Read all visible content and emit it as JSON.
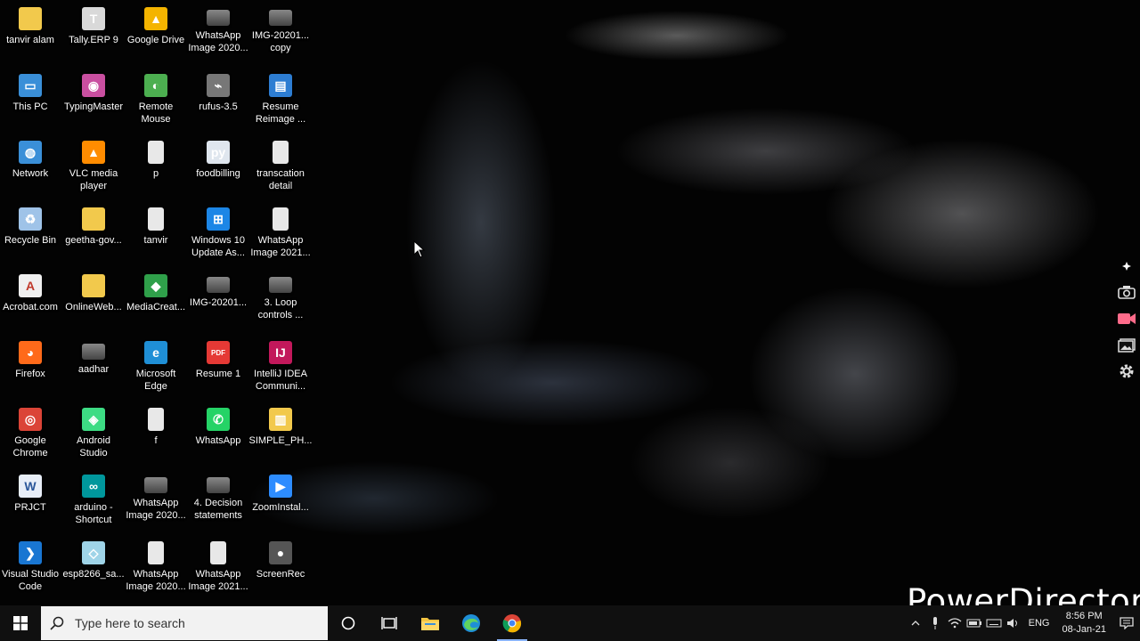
{
  "desktop": {
    "icons": [
      {
        "label": "tanvir alam",
        "icon": "user-folder-icon"
      },
      {
        "label": "Tally.ERP 9",
        "icon": "tally-icon"
      },
      {
        "label": "Google Drive",
        "icon": "google-drive-icon"
      },
      {
        "label": "WhatsApp\nImage 2020...",
        "icon": "image-file-icon"
      },
      {
        "label": "IMG-20201...\ncopy",
        "icon": "image-file-icon"
      },
      {
        "label": "This PC",
        "icon": "computer-icon"
      },
      {
        "label": "TypingMaster",
        "icon": "typingmaster-icon"
      },
      {
        "label": "Remote\nMouse",
        "icon": "remote-mouse-icon"
      },
      {
        "label": "rufus-3.5",
        "icon": "usb-icon"
      },
      {
        "label": "Resume\nReimage ...",
        "icon": "resume-icon"
      },
      {
        "label": "Network",
        "icon": "network-icon"
      },
      {
        "label": "VLC media\nplayer",
        "icon": "vlc-icon"
      },
      {
        "label": "p",
        "icon": "document-icon"
      },
      {
        "label": "foodbilling",
        "icon": "python-file-icon"
      },
      {
        "label": "transcation\ndetail",
        "icon": "document-icon"
      },
      {
        "label": "Recycle Bin",
        "icon": "recycle-bin-icon"
      },
      {
        "label": "geetha-gov...",
        "icon": "folder-icon"
      },
      {
        "label": "tanvir",
        "icon": "document-icon"
      },
      {
        "label": "Windows 10\nUpdate As...",
        "icon": "windows-icon"
      },
      {
        "label": "WhatsApp\nImage 2021...",
        "icon": "document-icon"
      },
      {
        "label": "Acrobat.com",
        "icon": "acrobat-icon"
      },
      {
        "label": "OnlineWeb...",
        "icon": "folder-icon"
      },
      {
        "label": "MediaCreat...",
        "icon": "media-creation-icon"
      },
      {
        "label": "IMG-20201...",
        "icon": "image-file-icon"
      },
      {
        "label": "3. Loop\ncontrols ...",
        "icon": "image-file-icon"
      },
      {
        "label": "Firefox",
        "icon": "firefox-icon"
      },
      {
        "label": "aadhar",
        "icon": "image-file-icon"
      },
      {
        "label": "Microsoft\nEdge",
        "icon": "edge-icon"
      },
      {
        "label": "Resume 1",
        "icon": "pdf-icon"
      },
      {
        "label": "IntelliJ IDEA\nCommuni...",
        "icon": "intellij-icon"
      },
      {
        "label": "Google\nChrome",
        "icon": "chrome-icon"
      },
      {
        "label": "Android\nStudio",
        "icon": "android-studio-icon"
      },
      {
        "label": "f",
        "icon": "document-icon"
      },
      {
        "label": "WhatsApp",
        "icon": "whatsapp-icon"
      },
      {
        "label": "SIMPLE_PH...",
        "icon": "zip-folder-icon"
      },
      {
        "label": "PRJCT",
        "icon": "word-doc-icon"
      },
      {
        "label": "arduino -\nShortcut",
        "icon": "arduino-icon"
      },
      {
        "label": "WhatsApp\nImage 2020...",
        "icon": "image-file-icon"
      },
      {
        "label": "4. Decision\nstatements",
        "icon": "image-file-icon"
      },
      {
        "label": "ZoomInstal...",
        "icon": "zoom-icon"
      },
      {
        "label": "Visual Studio\nCode",
        "icon": "vscode-icon"
      },
      {
        "label": "esp8266_sa...",
        "icon": "arduino-file-icon"
      },
      {
        "label": "WhatsApp\nImage 2020...",
        "icon": "document-icon"
      },
      {
        "label": "WhatsApp\nImage 2021...",
        "icon": "document-icon"
      },
      {
        "label": "ScreenRec",
        "icon": "screenrec-icon"
      }
    ]
  },
  "watermark": "PowerDirector",
  "taskbar": {
    "search_placeholder": "Type here to search",
    "pinned": [
      {
        "icon": "cortana-icon"
      },
      {
        "icon": "task-view-icon"
      },
      {
        "icon": "file-explorer-icon"
      },
      {
        "icon": "edge-icon"
      },
      {
        "icon": "chrome-icon",
        "active": true
      }
    ],
    "tray": {
      "language": "ENG",
      "time": "8:56 PM",
      "date": "08-Jan-21"
    }
  },
  "side_toolbar": [
    "pin-icon",
    "camera-icon",
    "video-camera-icon",
    "gallery-icon",
    "gear-icon"
  ],
  "colors": {
    "taskbar_bg": "#101010",
    "search_bg": "#f2f2f2",
    "accent": "#8ab4f8"
  }
}
